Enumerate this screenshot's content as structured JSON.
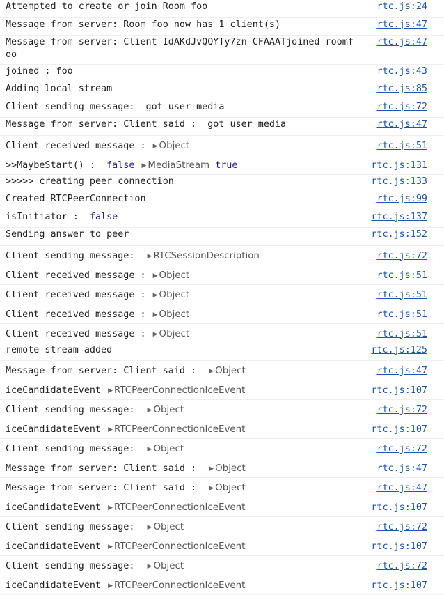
{
  "log": [
    {
      "parts": [
        {
          "t": "text",
          "v": "Attempted to create or join Room foo"
        }
      ],
      "src": "rtc.js:24"
    },
    {
      "parts": [
        {
          "t": "text",
          "v": "Message from server: Room foo now has 1 client(s)"
        }
      ],
      "src": "rtc.js:47"
    },
    {
      "parts": [
        {
          "t": "text",
          "v": "Message from server: Client IdAKdJvQQYTy7zn-CFAAATjoined roomfoo"
        }
      ],
      "src": "rtc.js:47",
      "lines": 2
    },
    {
      "parts": [
        {
          "t": "text",
          "v": "joined : foo"
        }
      ],
      "src": "rtc.js:43"
    },
    {
      "parts": [
        {
          "t": "text",
          "v": "Adding local stream"
        }
      ],
      "src": "rtc.js:85"
    },
    {
      "parts": [
        {
          "t": "text",
          "v": "Client sending message:  got user media"
        }
      ],
      "src": "rtc.js:72"
    },
    {
      "parts": [
        {
          "t": "text",
          "v": "Message from server: Client said :  got user media"
        }
      ],
      "src": "rtc.js:47"
    },
    {
      "parts": [
        {
          "t": "text",
          "v": "Client received message : "
        },
        {
          "t": "obj",
          "v": "Object"
        }
      ],
      "src": "rtc.js:51"
    },
    {
      "parts": [
        {
          "t": "text",
          "v": ">>MaybeStart() :  "
        },
        {
          "t": "kw",
          "v": "false"
        },
        {
          "t": "text",
          "v": " "
        },
        {
          "t": "obj",
          "v": "MediaStream"
        },
        {
          "t": "text",
          "v": " "
        },
        {
          "t": "kw",
          "v": "true"
        }
      ],
      "src": "rtc.js:131"
    },
    {
      "parts": [
        {
          "t": "text",
          "v": ">>>>> creating peer connection"
        }
      ],
      "src": "rtc.js:133"
    },
    {
      "parts": [
        {
          "t": "text",
          "v": "Created RTCPeerConnection"
        }
      ],
      "src": "rtc.js:99"
    },
    {
      "parts": [
        {
          "t": "text",
          "v": "isInitiator :  "
        },
        {
          "t": "kw",
          "v": "false"
        }
      ],
      "src": "rtc.js:137"
    },
    {
      "parts": [
        {
          "t": "text",
          "v": "Sending answer to peer"
        }
      ],
      "src": "rtc.js:152"
    },
    {
      "parts": [
        {
          "t": "text",
          "v": "Client sending message:  "
        },
        {
          "t": "obj",
          "v": "RTCSessionDescription"
        }
      ],
      "src": "rtc.js:72"
    },
    {
      "parts": [
        {
          "t": "text",
          "v": "Client received message : "
        },
        {
          "t": "obj",
          "v": "Object"
        }
      ],
      "src": "rtc.js:51"
    },
    {
      "parts": [
        {
          "t": "text",
          "v": "Client received message : "
        },
        {
          "t": "obj",
          "v": "Object"
        }
      ],
      "src": "rtc.js:51"
    },
    {
      "parts": [
        {
          "t": "text",
          "v": "Client received message : "
        },
        {
          "t": "obj",
          "v": "Object"
        }
      ],
      "src": "rtc.js:51"
    },
    {
      "parts": [
        {
          "t": "text",
          "v": "Client received message : "
        },
        {
          "t": "obj",
          "v": "Object"
        }
      ],
      "src": "rtc.js:51"
    },
    {
      "parts": [
        {
          "t": "text",
          "v": "remote stream added"
        }
      ],
      "src": "rtc.js:125"
    },
    {
      "parts": [
        {
          "t": "text",
          "v": "Message from server: Client said :  "
        },
        {
          "t": "obj",
          "v": "Object"
        }
      ],
      "src": "rtc.js:47"
    },
    {
      "parts": [
        {
          "t": "text",
          "v": "iceCandidateEvent "
        },
        {
          "t": "obj",
          "v": "RTCPeerConnectionIceEvent"
        }
      ],
      "src": "rtc.js:107"
    },
    {
      "parts": [
        {
          "t": "text",
          "v": "Client sending message:  "
        },
        {
          "t": "obj",
          "v": "Object"
        }
      ],
      "src": "rtc.js:72"
    },
    {
      "parts": [
        {
          "t": "text",
          "v": "iceCandidateEvent "
        },
        {
          "t": "obj",
          "v": "RTCPeerConnectionIceEvent"
        }
      ],
      "src": "rtc.js:107"
    },
    {
      "parts": [
        {
          "t": "text",
          "v": "Client sending message:  "
        },
        {
          "t": "obj",
          "v": "Object"
        }
      ],
      "src": "rtc.js:72"
    },
    {
      "parts": [
        {
          "t": "text",
          "v": "Message from server: Client said :  "
        },
        {
          "t": "obj",
          "v": "Object"
        }
      ],
      "src": "rtc.js:47"
    },
    {
      "parts": [
        {
          "t": "text",
          "v": "Message from server: Client said :  "
        },
        {
          "t": "obj",
          "v": "Object"
        }
      ],
      "src": "rtc.js:47"
    },
    {
      "parts": [
        {
          "t": "text",
          "v": "iceCandidateEvent "
        },
        {
          "t": "obj",
          "v": "RTCPeerConnectionIceEvent"
        }
      ],
      "src": "rtc.js:107"
    },
    {
      "parts": [
        {
          "t": "text",
          "v": "Client sending message:  "
        },
        {
          "t": "obj",
          "v": "Object"
        }
      ],
      "src": "rtc.js:72"
    },
    {
      "parts": [
        {
          "t": "text",
          "v": "iceCandidateEvent "
        },
        {
          "t": "obj",
          "v": "RTCPeerConnectionIceEvent"
        }
      ],
      "src": "rtc.js:107"
    },
    {
      "parts": [
        {
          "t": "text",
          "v": "Client sending message:  "
        },
        {
          "t": "obj",
          "v": "Object"
        }
      ],
      "src": "rtc.js:72"
    },
    {
      "parts": [
        {
          "t": "text",
          "v": "iceCandidateEvent "
        },
        {
          "t": "obj",
          "v": "RTCPeerConnectionIceEvent"
        }
      ],
      "src": "rtc.js:107"
    }
  ],
  "colors": {
    "link": "#1a55b8",
    "keyword": "#1c1ca8",
    "text": "#222222",
    "object": "#555555",
    "divider": "#efefef"
  },
  "icons": {
    "expand": "expand-triangle-icon"
  }
}
